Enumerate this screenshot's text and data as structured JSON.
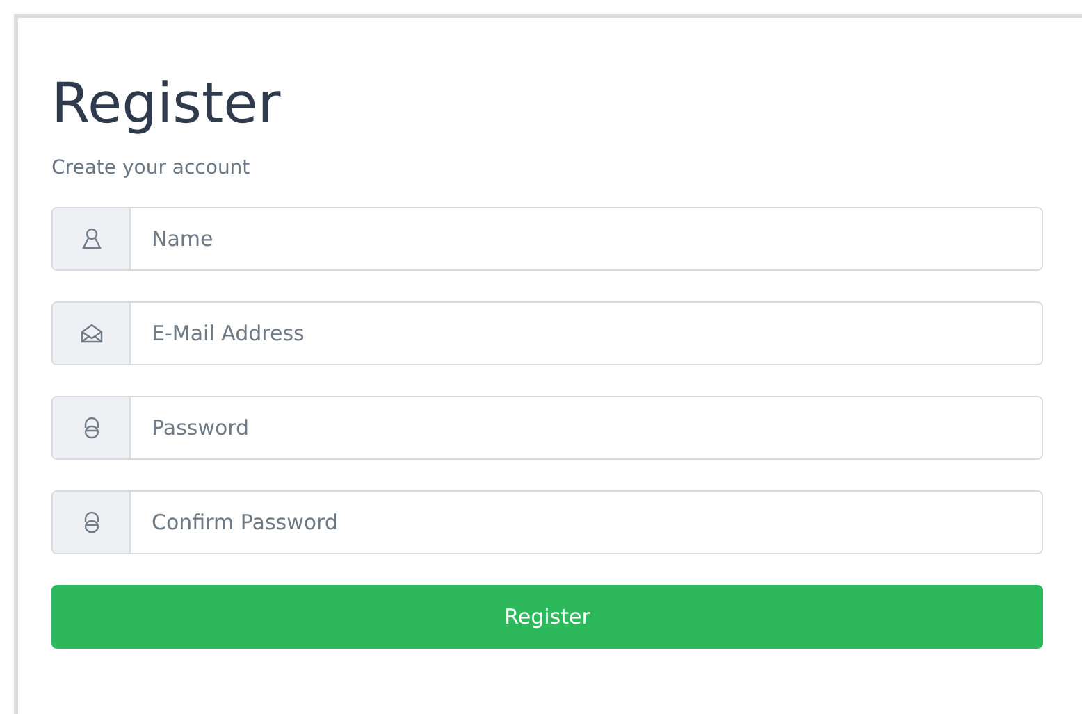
{
  "title": "Register",
  "subtitle": "Create your account",
  "fields": [
    {
      "kind": "person",
      "placeholder": "Name"
    },
    {
      "kind": "mail",
      "placeholder": "E-Mail Address"
    },
    {
      "kind": "lock",
      "placeholder": "Password"
    },
    {
      "kind": "lock",
      "placeholder": "Confirm Password"
    }
  ],
  "button": "Register"
}
